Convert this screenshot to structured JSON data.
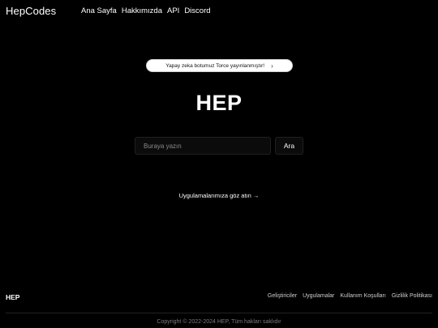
{
  "header": {
    "brand": "HepCodes",
    "nav": [
      "Ana Sayfa",
      "Hakkımızda",
      "API",
      "Discord"
    ]
  },
  "announcement": {
    "text": "Yapay zeka botumuz Torce yayınlanmıştır!",
    "chevron": "›"
  },
  "hero": {
    "title": "HEP"
  },
  "search": {
    "placeholder": "Buraya yazın",
    "value": "",
    "button_label": "Ara"
  },
  "apps_link": "Uygulamalarımıza göz atın →",
  "footer": {
    "brand": "HEP",
    "links": [
      "Geliştiriciler",
      "Uygulamalar",
      "Kullanım Koşulları",
      "Gizlilik Politikası"
    ],
    "copyright": "Copyright © 2022-2024 HEP, Tüm hakları saklıdır"
  },
  "colors": {
    "background": "#000000",
    "text": "#ffffff",
    "announcement_bg": "#ffffff",
    "input_bg": "#0b0b0b",
    "muted": "#7a7a7a"
  }
}
